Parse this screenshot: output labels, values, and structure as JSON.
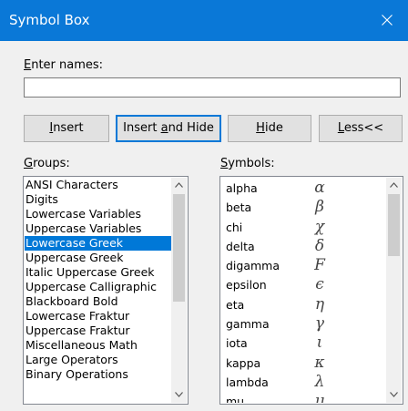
{
  "window": {
    "title": "Symbol Box"
  },
  "names": {
    "label": "Enter names:",
    "underline_char": "E",
    "label_rest": "nter names:",
    "value": ""
  },
  "buttons": [
    {
      "name": "insert-button",
      "pre": "",
      "u": "I",
      "post": "nsert",
      "default": false
    },
    {
      "name": "insert-and-hide-button",
      "pre": "Insert ",
      "u": "a",
      "post": "nd Hide",
      "default": true
    },
    {
      "name": "hide-button",
      "pre": "",
      "u": "H",
      "post": "ide",
      "default": false
    },
    {
      "name": "less-button",
      "pre": "",
      "u": "L",
      "post": "ess<<",
      "default": false
    }
  ],
  "groups": {
    "label_u": "G",
    "label_rest": "roups:",
    "selected": "Lowercase Greek",
    "items": [
      "ANSI Characters",
      "Digits",
      "Lowercase Variables",
      "Uppercase Variables",
      "Lowercase Greek",
      "Uppercase Greek",
      "Italic Uppercase Greek",
      "Uppercase Calligraphic",
      "Blackboard Bold",
      "Lowercase Fraktur",
      "Uppercase Fraktur",
      "Miscellaneous Math",
      "Large Operators",
      "Binary Operations"
    ]
  },
  "symbols": {
    "label_u": "S",
    "label_rest": "ymbols:",
    "items": [
      {
        "name": "alpha",
        "glyph": "α"
      },
      {
        "name": "beta",
        "glyph": "β"
      },
      {
        "name": "chi",
        "glyph": "χ"
      },
      {
        "name": "delta",
        "glyph": "δ"
      },
      {
        "name": "digamma",
        "glyph": "F"
      },
      {
        "name": "epsilon",
        "glyph": "ϵ"
      },
      {
        "name": "eta",
        "glyph": "η"
      },
      {
        "name": "gamma",
        "glyph": "γ"
      },
      {
        "name": "iota",
        "glyph": "ι"
      },
      {
        "name": "kappa",
        "glyph": "κ"
      },
      {
        "name": "lambda",
        "glyph": "λ"
      },
      {
        "name": "mu",
        "glyph": "μ"
      }
    ]
  },
  "icons": {
    "close": "close-icon",
    "scroll_up": "chevron-up-icon",
    "scroll_down": "chevron-down-icon"
  },
  "colors": {
    "titlebar": "#0a78d7",
    "selection": "#0078d7"
  }
}
